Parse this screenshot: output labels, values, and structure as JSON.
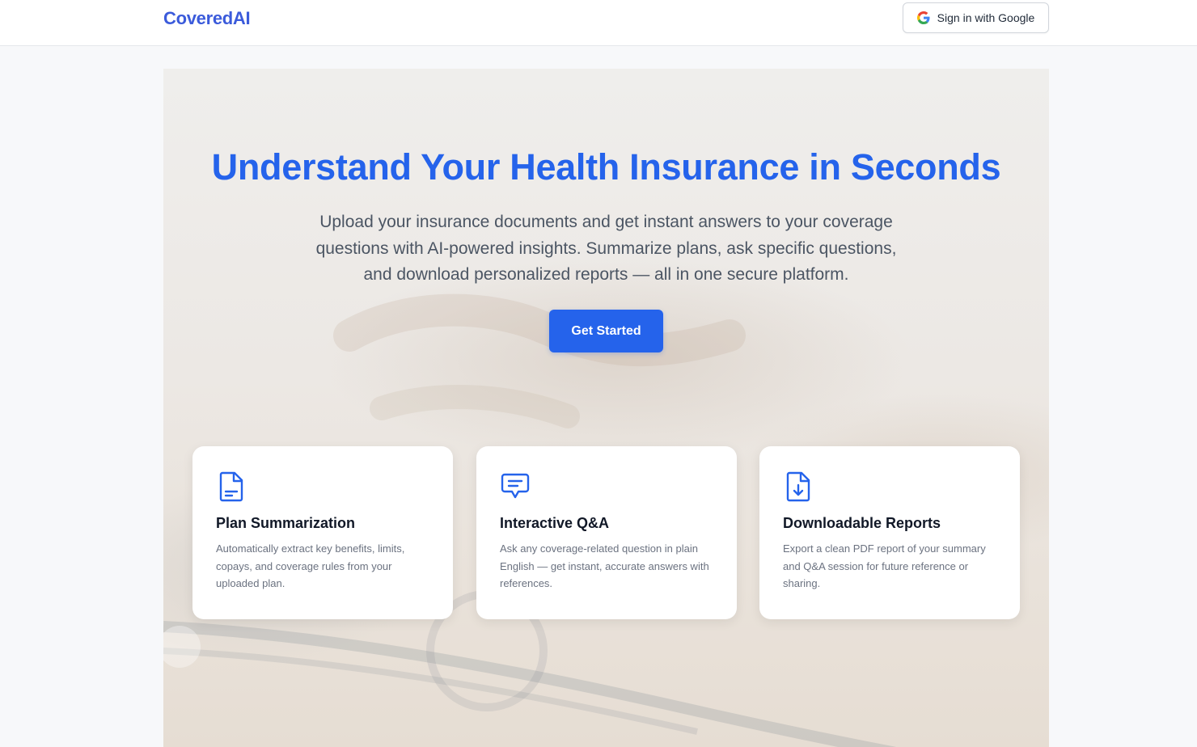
{
  "navbar": {
    "brand": "CoveredAI",
    "signin_label": "Sign in with Google"
  },
  "hero": {
    "title": "Understand Your Health Insurance in Seconds",
    "subtitle": "Upload your insurance documents and get instant answers to your coverage questions with AI-powered insights. Summarize plans, ask specific questions, and download personalized reports — all in one secure platform.",
    "cta_label": "Get Started"
  },
  "features": [
    {
      "icon": "document-text-icon",
      "title": "Plan Summarization",
      "description": "Automatically extract key benefits, limits, copays, and coverage rules from your uploaded plan."
    },
    {
      "icon": "chat-bubble-icon",
      "title": "Interactive Q&A",
      "description": "Ask any coverage-related question in plain English — get instant, accurate answers with references."
    },
    {
      "icon": "document-download-icon",
      "title": "Downloadable Reports",
      "description": "Export a clean PDF report of your summary and Q&A session for future reference or sharing."
    }
  ],
  "colors": {
    "brand": "#3b5bdb",
    "accent": "#2563eb"
  }
}
